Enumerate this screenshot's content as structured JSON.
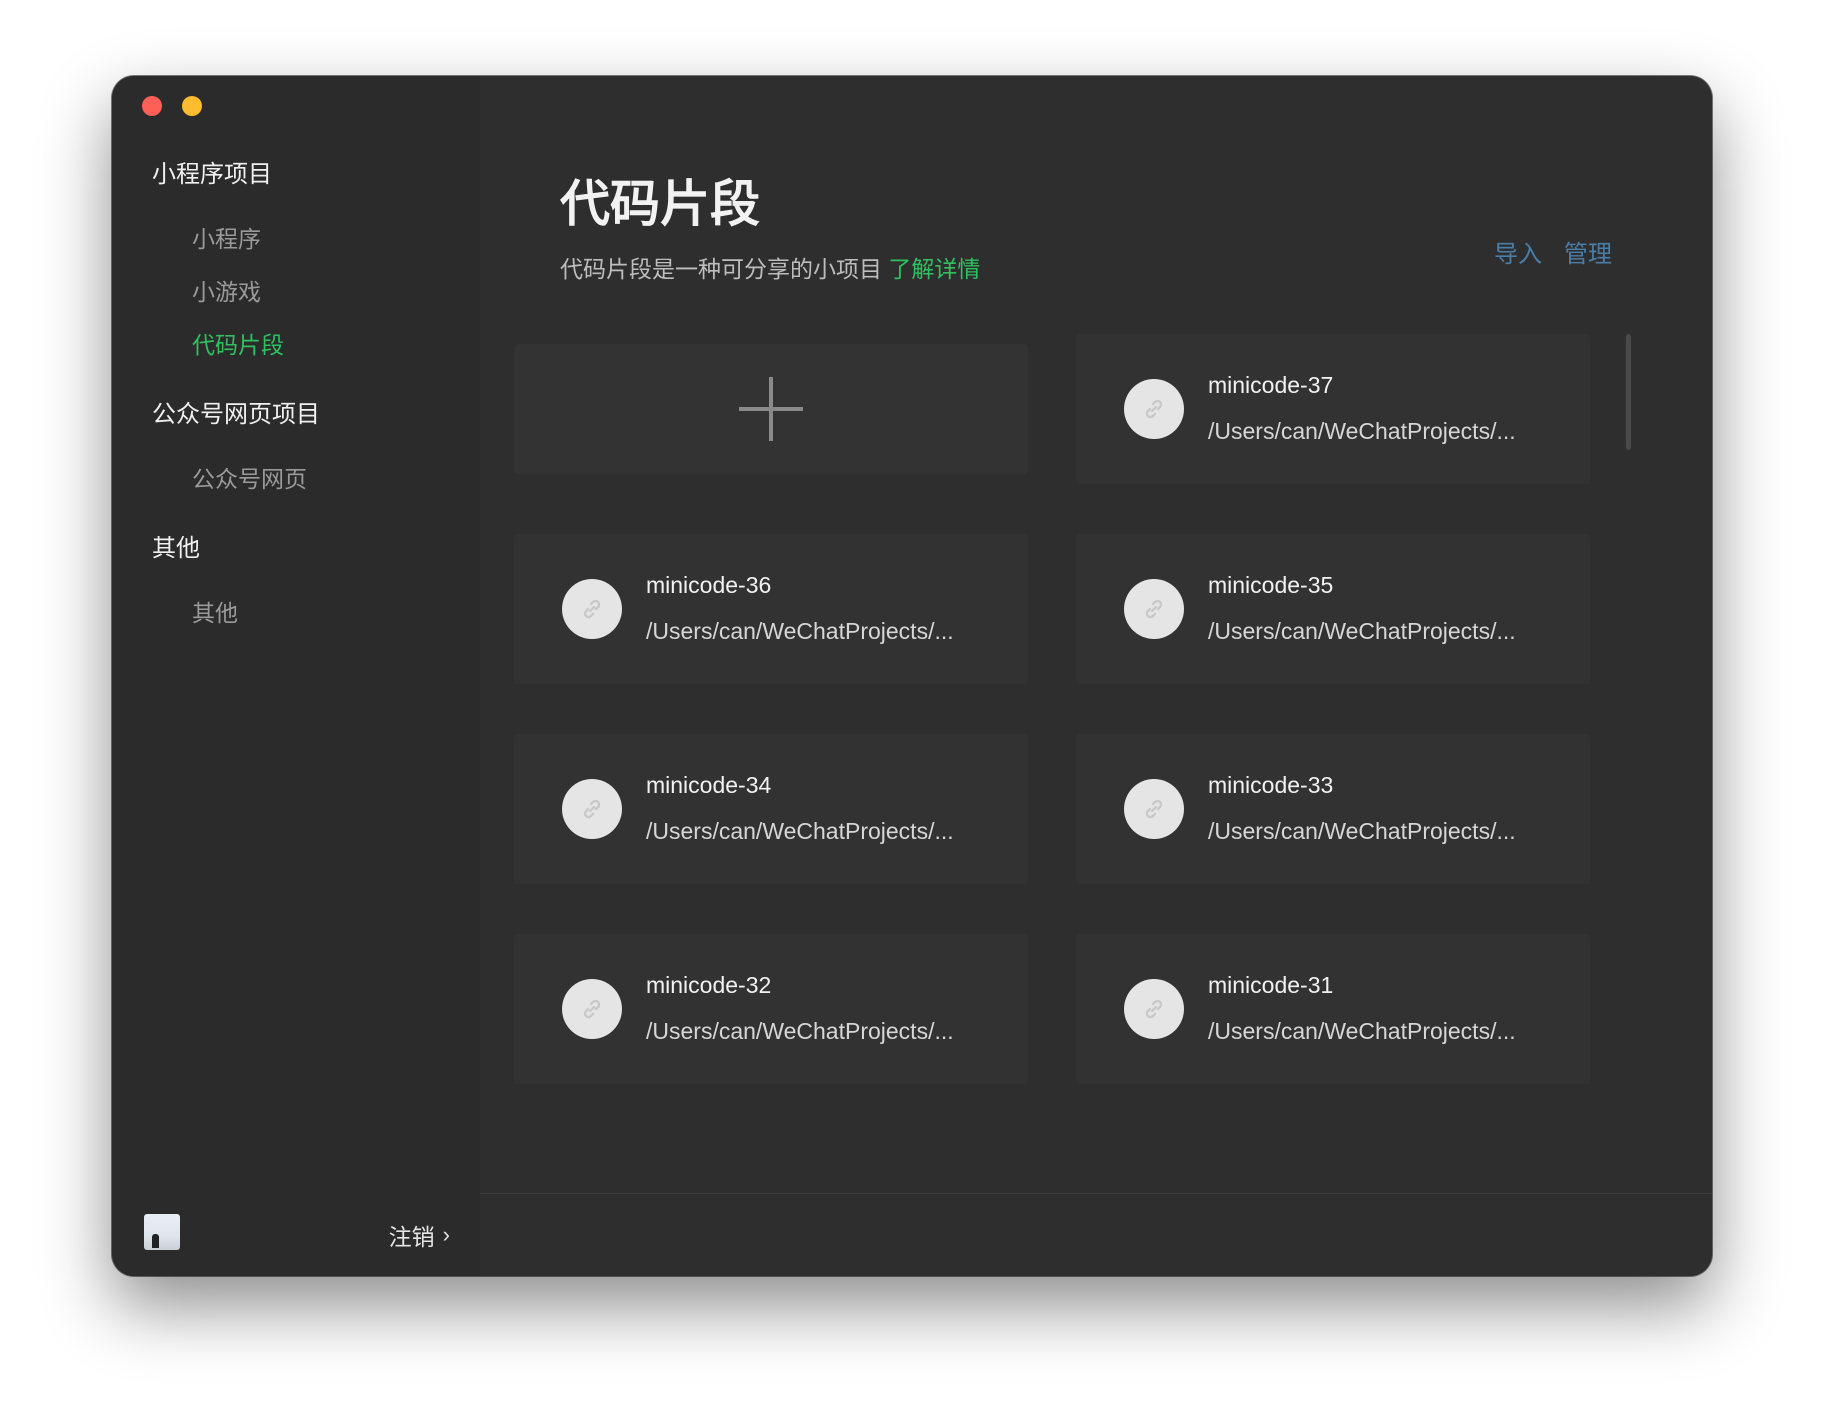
{
  "window": {
    "controls": [
      "close",
      "minimize"
    ]
  },
  "sidebar": {
    "groups": [
      {
        "title": "小程序项目",
        "items": [
          {
            "label": "小程序",
            "active": false
          },
          {
            "label": "小游戏",
            "active": false
          },
          {
            "label": "代码片段",
            "active": true
          }
        ]
      },
      {
        "title": "公众号网页项目",
        "items": [
          {
            "label": "公众号网页",
            "active": false
          }
        ]
      },
      {
        "title": "其他",
        "items": [
          {
            "label": "其他",
            "active": false
          }
        ]
      }
    ],
    "footer": {
      "logout_label": "注销",
      "chevron": "›"
    }
  },
  "main": {
    "title": "代码片段",
    "subtitle": "代码片段是一种可分享的小项目",
    "learn_more": "了解详情",
    "actions": {
      "import": "导入",
      "manage": "管理"
    },
    "projects": [
      {
        "name": "minicode-37",
        "path": "/Users/can/WeChatProjects/..."
      },
      {
        "name": "minicode-36",
        "path": "/Users/can/WeChatProjects/..."
      },
      {
        "name": "minicode-35",
        "path": "/Users/can/WeChatProjects/..."
      },
      {
        "name": "minicode-34",
        "path": "/Users/can/WeChatProjects/..."
      },
      {
        "name": "minicode-33",
        "path": "/Users/can/WeChatProjects/..."
      },
      {
        "name": "minicode-32",
        "path": "/Users/can/WeChatProjects/..."
      },
      {
        "name": "minicode-31",
        "path": "/Users/can/WeChatProjects/..."
      }
    ]
  },
  "colors": {
    "accent_green": "#2fc160",
    "link_blue": "#4a7ea8",
    "sidebar_bg": "#2b2b2b",
    "main_bg": "#2e2e2e",
    "card_bg": "#323232"
  },
  "icons": {
    "project_icon": "link-icon",
    "add_icon": "plus-icon"
  }
}
